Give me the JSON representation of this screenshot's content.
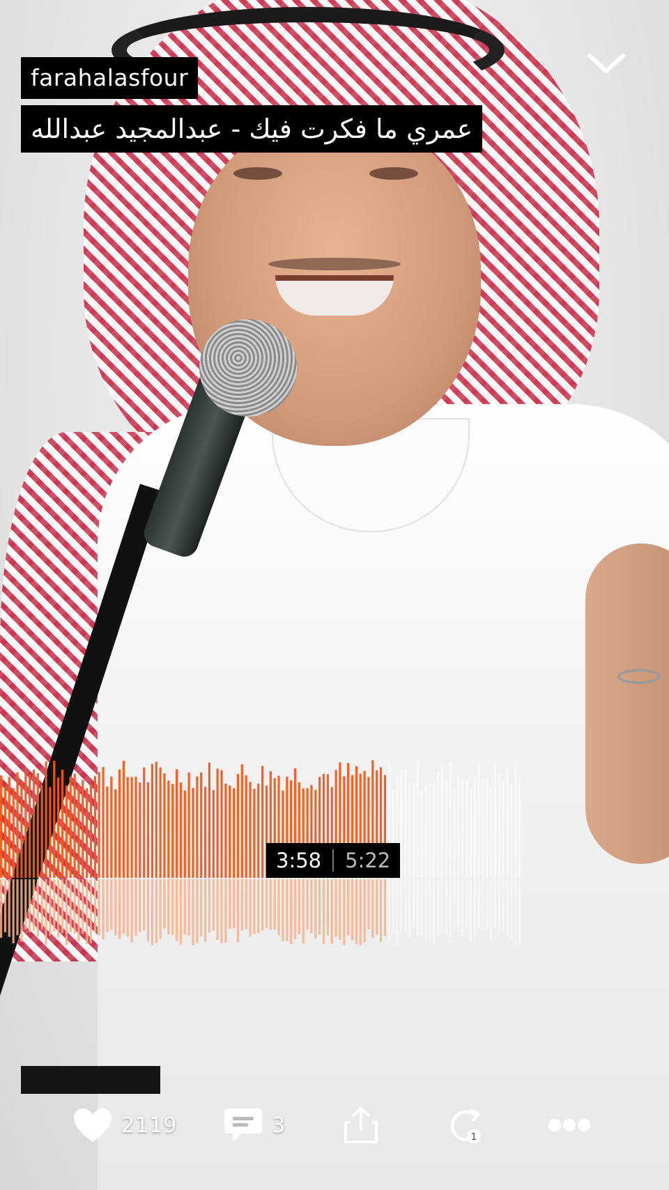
{
  "track": {
    "username": "farahalasfour",
    "title": "عمري ما فكرت فيك - عبدالمجيد عبدالله"
  },
  "player": {
    "current_time": "3:58",
    "total_time": "5:22",
    "progress": 0.74,
    "played_color": "#f05a1c",
    "played_reflection_color": "#f7b08a",
    "unplayed_color": "#ffffff"
  },
  "actions": {
    "likes": "2119",
    "comments": "3",
    "like_icon": "heart-icon",
    "comment_icon": "comment-icon",
    "share_icon": "share-icon",
    "repost_icon": "repost-icon",
    "repost_badge": "1",
    "more_icon": "more-icon"
  },
  "navigation": {
    "collapse_icon": "chevron-down-icon"
  }
}
